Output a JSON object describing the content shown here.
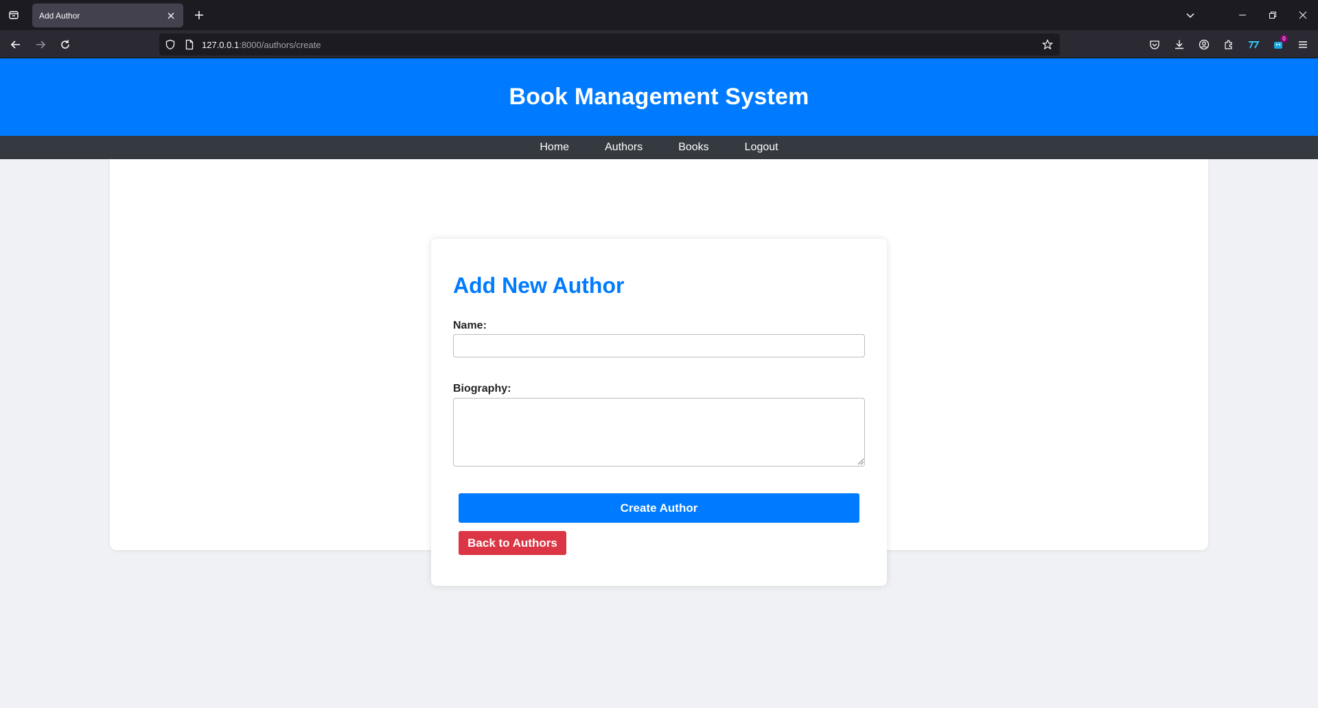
{
  "browser": {
    "tab_title": "Add Author",
    "url_host": "127.0.0.1",
    "url_rest": ":8000/authors/create",
    "extension_badge": "0"
  },
  "site": {
    "title": "Book Management System",
    "nav": [
      {
        "label": "Home"
      },
      {
        "label": "Authors"
      },
      {
        "label": "Books"
      },
      {
        "label": "Logout"
      }
    ]
  },
  "form": {
    "heading": "Add New Author",
    "name_label": "Name:",
    "name_value": "",
    "biography_label": "Biography:",
    "biography_value": "",
    "submit_label": "Create Author",
    "back_label": "Back to Authors"
  },
  "colors": {
    "header_bg": "#007bff",
    "nav_bg": "#343a40",
    "primary": "#007bff",
    "danger": "#dc3545"
  }
}
